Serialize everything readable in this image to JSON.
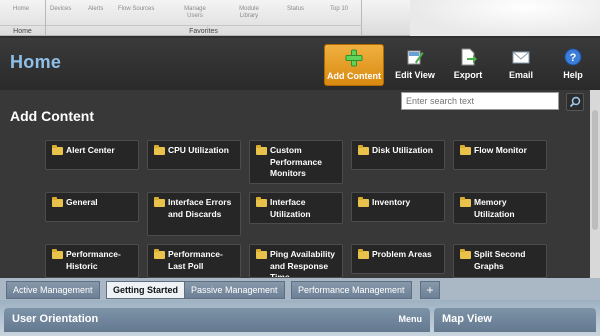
{
  "ribbon": {
    "groups": [
      {
        "label": "Home",
        "items": [
          "Home"
        ]
      },
      {
        "label": "Favorites",
        "items": [
          "Devices",
          "Alerts",
          "Flow Sources",
          "Manage Users",
          "Module Library",
          "Status",
          "Top 10"
        ]
      }
    ]
  },
  "header": {
    "title": "Home",
    "buttons": [
      {
        "label": "Add Content",
        "icon": "plus-icon"
      },
      {
        "label": "Edit View",
        "icon": "edit-icon"
      },
      {
        "label": "Export",
        "icon": "export-icon"
      },
      {
        "label": "Email",
        "icon": "email-icon"
      },
      {
        "label": "Help",
        "icon": "help-icon"
      }
    ]
  },
  "panel": {
    "title": "Add Content",
    "search_placeholder": "Enter search text",
    "tiles": [
      "Alert Center",
      "CPU Utilization",
      "Custom Performance Monitors",
      "Disk Utilization",
      "Flow Monitor",
      "General",
      "Interface Errors and Discards",
      "Interface Utilization",
      "Inventory",
      "Memory Utilization",
      "Performance-Historic",
      "Performance-Last Poll",
      "Ping Availability and Response Time",
      "Problem Areas",
      "Split Second Graphs"
    ]
  },
  "tabs": {
    "items": [
      "Active Management",
      "Getting Started",
      "Passive Management",
      "Performance Management"
    ],
    "active_index": 1,
    "add_label": "+"
  },
  "bottom": {
    "left_pane": {
      "title": "User Orientation",
      "menu_label": "Menu"
    },
    "right_pane": {
      "title": "Map View"
    }
  },
  "colors": {
    "accent": "#e09a20",
    "title_blue": "#8fc0e8",
    "tab_blue": "#6d8096"
  }
}
